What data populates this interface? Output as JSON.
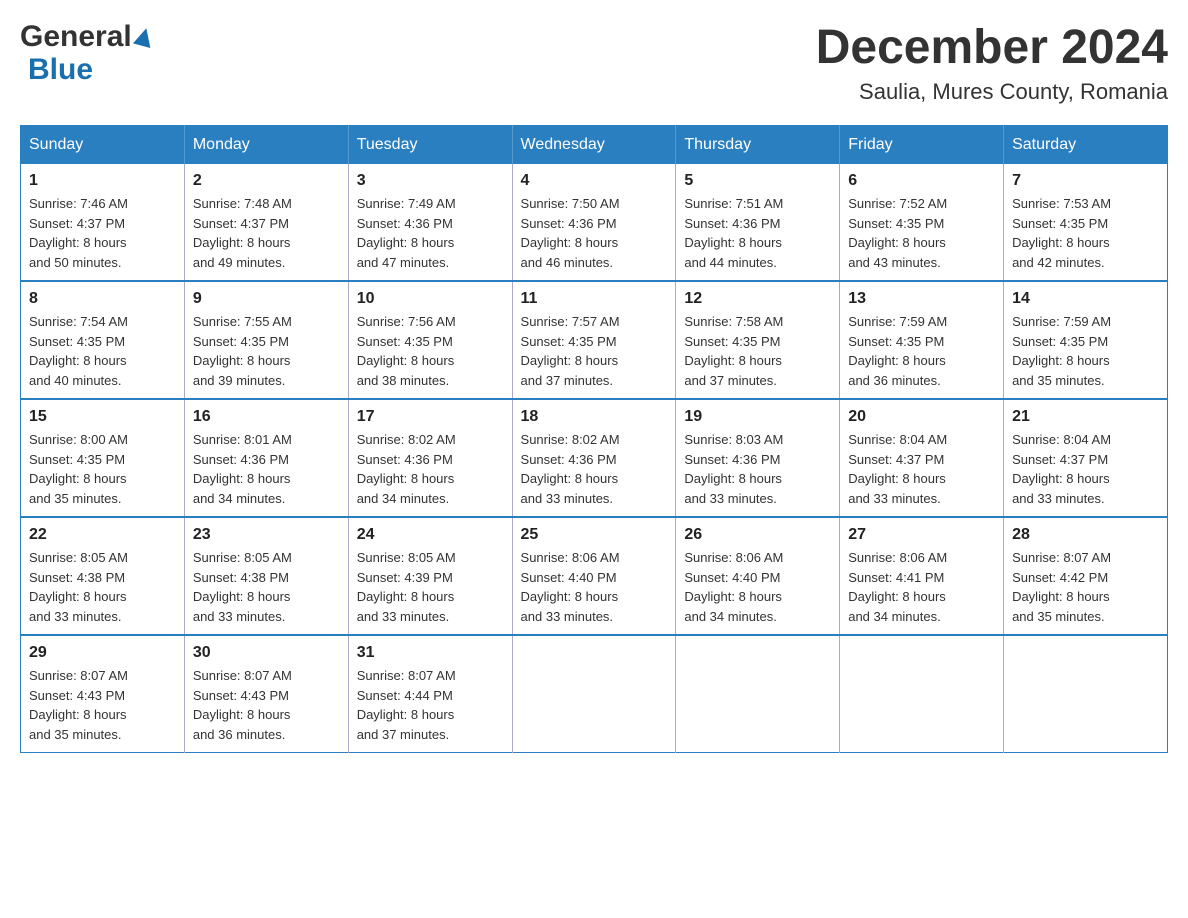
{
  "logo": {
    "general": "General",
    "blue": "Blue"
  },
  "header": {
    "title": "December 2024",
    "subtitle": "Saulia, Mures County, Romania"
  },
  "days_of_week": [
    "Sunday",
    "Monday",
    "Tuesday",
    "Wednesday",
    "Thursday",
    "Friday",
    "Saturday"
  ],
  "weeks": [
    [
      {
        "day": "1",
        "sunrise": "7:46 AM",
        "sunset": "4:37 PM",
        "daylight": "8 hours and 50 minutes."
      },
      {
        "day": "2",
        "sunrise": "7:48 AM",
        "sunset": "4:37 PM",
        "daylight": "8 hours and 49 minutes."
      },
      {
        "day": "3",
        "sunrise": "7:49 AM",
        "sunset": "4:36 PM",
        "daylight": "8 hours and 47 minutes."
      },
      {
        "day": "4",
        "sunrise": "7:50 AM",
        "sunset": "4:36 PM",
        "daylight": "8 hours and 46 minutes."
      },
      {
        "day": "5",
        "sunrise": "7:51 AM",
        "sunset": "4:36 PM",
        "daylight": "8 hours and 44 minutes."
      },
      {
        "day": "6",
        "sunrise": "7:52 AM",
        "sunset": "4:35 PM",
        "daylight": "8 hours and 43 minutes."
      },
      {
        "day": "7",
        "sunrise": "7:53 AM",
        "sunset": "4:35 PM",
        "daylight": "8 hours and 42 minutes."
      }
    ],
    [
      {
        "day": "8",
        "sunrise": "7:54 AM",
        "sunset": "4:35 PM",
        "daylight": "8 hours and 40 minutes."
      },
      {
        "day": "9",
        "sunrise": "7:55 AM",
        "sunset": "4:35 PM",
        "daylight": "8 hours and 39 minutes."
      },
      {
        "day": "10",
        "sunrise": "7:56 AM",
        "sunset": "4:35 PM",
        "daylight": "8 hours and 38 minutes."
      },
      {
        "day": "11",
        "sunrise": "7:57 AM",
        "sunset": "4:35 PM",
        "daylight": "8 hours and 37 minutes."
      },
      {
        "day": "12",
        "sunrise": "7:58 AM",
        "sunset": "4:35 PM",
        "daylight": "8 hours and 37 minutes."
      },
      {
        "day": "13",
        "sunrise": "7:59 AM",
        "sunset": "4:35 PM",
        "daylight": "8 hours and 36 minutes."
      },
      {
        "day": "14",
        "sunrise": "7:59 AM",
        "sunset": "4:35 PM",
        "daylight": "8 hours and 35 minutes."
      }
    ],
    [
      {
        "day": "15",
        "sunrise": "8:00 AM",
        "sunset": "4:35 PM",
        "daylight": "8 hours and 35 minutes."
      },
      {
        "day": "16",
        "sunrise": "8:01 AM",
        "sunset": "4:36 PM",
        "daylight": "8 hours and 34 minutes."
      },
      {
        "day": "17",
        "sunrise": "8:02 AM",
        "sunset": "4:36 PM",
        "daylight": "8 hours and 34 minutes."
      },
      {
        "day": "18",
        "sunrise": "8:02 AM",
        "sunset": "4:36 PM",
        "daylight": "8 hours and 33 minutes."
      },
      {
        "day": "19",
        "sunrise": "8:03 AM",
        "sunset": "4:36 PM",
        "daylight": "8 hours and 33 minutes."
      },
      {
        "day": "20",
        "sunrise": "8:04 AM",
        "sunset": "4:37 PM",
        "daylight": "8 hours and 33 minutes."
      },
      {
        "day": "21",
        "sunrise": "8:04 AM",
        "sunset": "4:37 PM",
        "daylight": "8 hours and 33 minutes."
      }
    ],
    [
      {
        "day": "22",
        "sunrise": "8:05 AM",
        "sunset": "4:38 PM",
        "daylight": "8 hours and 33 minutes."
      },
      {
        "day": "23",
        "sunrise": "8:05 AM",
        "sunset": "4:38 PM",
        "daylight": "8 hours and 33 minutes."
      },
      {
        "day": "24",
        "sunrise": "8:05 AM",
        "sunset": "4:39 PM",
        "daylight": "8 hours and 33 minutes."
      },
      {
        "day": "25",
        "sunrise": "8:06 AM",
        "sunset": "4:40 PM",
        "daylight": "8 hours and 33 minutes."
      },
      {
        "day": "26",
        "sunrise": "8:06 AM",
        "sunset": "4:40 PM",
        "daylight": "8 hours and 34 minutes."
      },
      {
        "day": "27",
        "sunrise": "8:06 AM",
        "sunset": "4:41 PM",
        "daylight": "8 hours and 34 minutes."
      },
      {
        "day": "28",
        "sunrise": "8:07 AM",
        "sunset": "4:42 PM",
        "daylight": "8 hours and 35 minutes."
      }
    ],
    [
      {
        "day": "29",
        "sunrise": "8:07 AM",
        "sunset": "4:43 PM",
        "daylight": "8 hours and 35 minutes."
      },
      {
        "day": "30",
        "sunrise": "8:07 AM",
        "sunset": "4:43 PM",
        "daylight": "8 hours and 36 minutes."
      },
      {
        "day": "31",
        "sunrise": "8:07 AM",
        "sunset": "4:44 PM",
        "daylight": "8 hours and 37 minutes."
      },
      null,
      null,
      null,
      null
    ]
  ],
  "labels": {
    "sunrise": "Sunrise:",
    "sunset": "Sunset:",
    "daylight": "Daylight:"
  }
}
